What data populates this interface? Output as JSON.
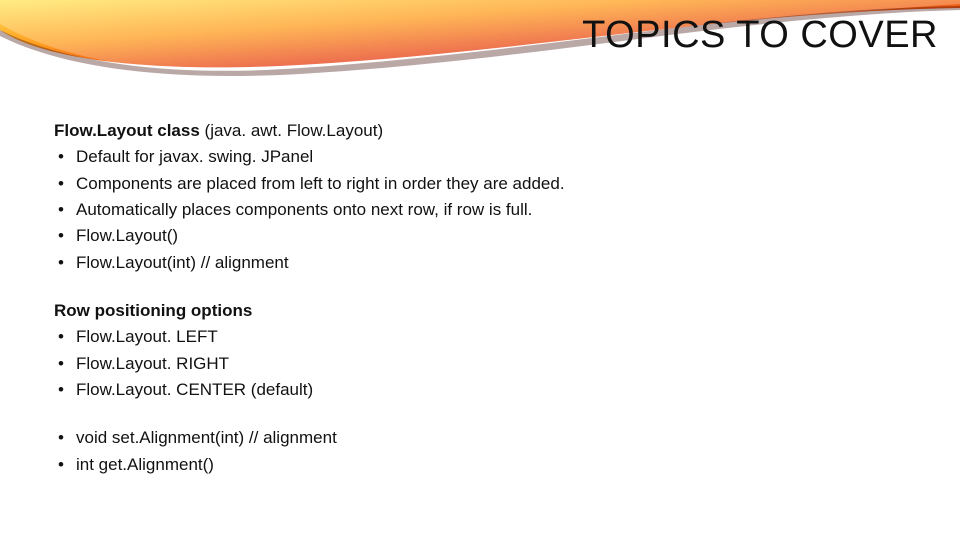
{
  "title": "TOPICS TO COVER",
  "section1": {
    "heading_bold": "Flow.Layout class ",
    "heading_rest": "(java. awt. Flow.Layout)",
    "items": [
      "Default for javax. swing. JPanel",
      "Components are placed from left to right in order they are added.",
      "Automatically places components onto next row, if row is full.",
      "Flow.Layout()",
      "Flow.Layout(int)           // alignment"
    ]
  },
  "section2": {
    "heading": "Row positioning options",
    "items": [
      "Flow.Layout. LEFT",
      "Flow.Layout. RIGHT",
      "Flow.Layout. CENTER (default)"
    ]
  },
  "section3": {
    "items": [
      "void   set.Alignment(int)          // alignment",
      "int  get.Alignment()"
    ]
  }
}
